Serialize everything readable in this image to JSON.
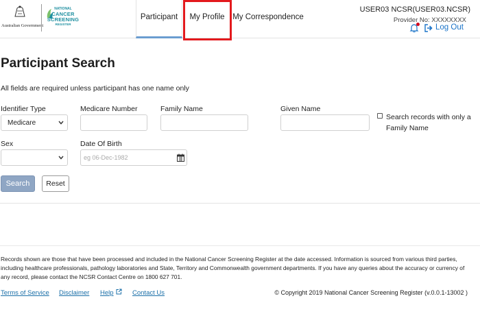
{
  "header": {
    "gov_logo_text": "Australian Government",
    "ncsr_logo": {
      "line1": "NATIONAL",
      "line2": "CANCER",
      "line3": "SCREENING",
      "line4": "REGISTER"
    },
    "nav": [
      {
        "label": "Participant",
        "active": true
      },
      {
        "label": "My Profile",
        "highlighted": true
      },
      {
        "label": "My Correspondence"
      }
    ],
    "user": "USER03 NCSR(USER03.NCSR)",
    "provider_no": "Provider No:  XXXXXXXX",
    "logout_label": "Log Out",
    "notification_color": "#d0021b",
    "highlight_color": "#e3191d",
    "icons": {
      "notifications": "bell-icon",
      "logout": "sign-out-icon"
    }
  },
  "main": {
    "title": "Participant Search",
    "requirement_note": "All fields are required unless participant has one name only",
    "form": {
      "identifier_type_label": "Identifier Type",
      "identifier_type_value": "Medicare",
      "medicare_label": "Medicare Number",
      "medicare_value": "",
      "family_name_label": "Family Name",
      "family_name_value": "",
      "given_name_label": "Given Name",
      "given_name_value": "",
      "family_only_label": "Search records with only a Family Name",
      "family_only_checked": false,
      "sex_label": "Sex",
      "sex_value": "",
      "dob_label": "Date Of Birth",
      "dob_placeholder": "eg 06-Dec-1982",
      "dob_value": ""
    },
    "buttons": {
      "search": "Search",
      "reset": "Reset"
    }
  },
  "footer": {
    "note": "Records shown are those that have been processed and included in the National Cancer Screening Register at the date accessed. Information is sourced from various third parties, including healthcare professionals, pathology laboratories and State, Territory and Commonwealth government departments. If you have any queries about the accuracy or currency of any record, please contact the NCSR Contact Centre on 1800 627 701.",
    "links": [
      "Terms of Service",
      "Disclaimer",
      "Help",
      "Contact Us"
    ],
    "copyright": "© Copyright 2019 National Cancer Screening Register (v.0.0.1-13002 )"
  },
  "colors": {
    "accent": "#1a73c8",
    "search_button": "#8fa6c4",
    "active_tab_underline": "#6a9dd0",
    "brand_teal": "#1e8fa0"
  }
}
